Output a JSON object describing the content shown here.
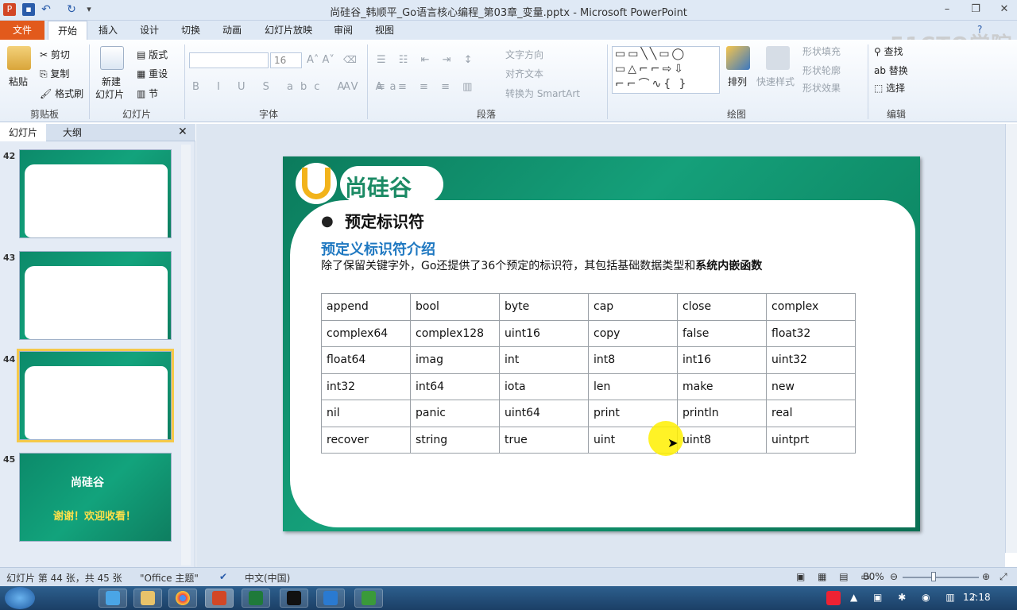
{
  "window": {
    "title": "尚硅谷_韩顺平_Go语言核心编程_第03章_变量.pptx - Microsoft PowerPoint"
  },
  "tabs": [
    "文件",
    "开始",
    "插入",
    "设计",
    "切换",
    "动画",
    "幻灯片放映",
    "审阅",
    "视图"
  ],
  "ribbon": {
    "clipboard": {
      "paste": "粘贴",
      "cut": "剪切",
      "copy": "复制",
      "format_painter": "格式刷",
      "label": "剪贴板"
    },
    "slides": {
      "new_slide": "新建",
      "new_slide2": "幻灯片",
      "layout": "版式",
      "reset": "重设",
      "section": "节",
      "label": "幻灯片"
    },
    "font": {
      "size": "16",
      "label": "字体"
    },
    "paragraph": {
      "text_direction": "文字方向",
      "align_text": "对齐文本",
      "smartart": "转换为 SmartArt",
      "label": "段落"
    },
    "drawing": {
      "arrange": "排列",
      "quick_styles": "快速样式",
      "shape_fill": "形状填充",
      "shape_outline": "形状轮廓",
      "shape_effects": "形状效果",
      "label": "绘图"
    },
    "editing": {
      "find": "查找",
      "replace": "替换",
      "select": "选择",
      "label": "编辑"
    }
  },
  "left_pane": {
    "tab_slides": "幻灯片",
    "tab_outline": "大纲",
    "slides": [
      {
        "num": "42"
      },
      {
        "num": "43"
      },
      {
        "num": "44"
      },
      {
        "num": "45",
        "thanks": "谢谢！欢迎收看！"
      }
    ]
  },
  "slide": {
    "logo_text": "尚硅谷",
    "bullet_title": "预定标识符",
    "sub_title": "预定义标识符介绍",
    "desc_plain": "除了保留关键字外，Go还提供了36个预定的标识符，其包括基础数据类型和",
    "desc_bold": "系统内嵌函数",
    "table": [
      [
        "append",
        "bool",
        "byte",
        "cap",
        "close",
        "complex"
      ],
      [
        "complex64",
        "complex128",
        "uint16",
        "copy",
        "false",
        "float32"
      ],
      [
        "float64",
        "imag",
        "int",
        "int8",
        "int16",
        "uint32"
      ],
      [
        "int32",
        "int64",
        "iota",
        "len",
        "make",
        "new"
      ],
      [
        "nil",
        "panic",
        "uint64",
        "print",
        "println",
        "real"
      ],
      [
        "recover",
        "string",
        "true",
        "uint",
        "uint8",
        "uintprt"
      ]
    ]
  },
  "status": {
    "slide_info": "幻灯片 第 44 张，共 45 张",
    "theme": "\"Office 主题\"",
    "language": "中文(中国)",
    "zoom": "80%"
  },
  "taskbar": {
    "clock": "12:18"
  },
  "watermark": "51CTO学院"
}
